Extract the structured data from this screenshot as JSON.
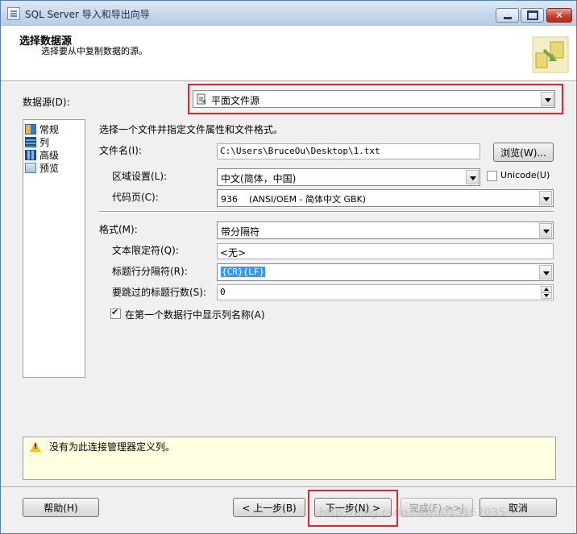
{
  "window": {
    "title": "SQL Server 导入和导出向导"
  },
  "header": {
    "title": "选择数据源",
    "subtitle": "选择要从中复制数据的源。"
  },
  "datasource": {
    "label": "数据源(D):",
    "value": "平面文件源"
  },
  "nav": {
    "items": [
      {
        "label": "常规",
        "icon": "general-icon"
      },
      {
        "label": "列",
        "icon": "columns-icon"
      },
      {
        "label": "高级",
        "icon": "advanced-icon"
      },
      {
        "label": "预览",
        "icon": "preview-icon"
      }
    ]
  },
  "form": {
    "intro": "选择一个文件并指定文件属性和文件格式。",
    "filename_label": "文件名(I):",
    "filename_value": "C:\\Users\\BruceOu\\Desktop\\1.txt",
    "browse_label": "浏览(W)...",
    "locale_label": "区域设置(L):",
    "locale_value": "中文(简体，中国)",
    "unicode_label": "Unicode(U)",
    "unicode_checked": false,
    "codepage_label": "代码页(C):",
    "codepage_value": "936    (ANSI/OEM - 简体中文 GBK)",
    "format_label": "格式(M):",
    "format_value": "带分隔符",
    "text_qualifier_label": "文本限定符(Q):",
    "text_qualifier_value": "<无>",
    "header_row_delim_label": "标题行分隔符(R):",
    "header_row_delim_value": "{CR}{LF}",
    "header_rows_skip_label": "要跳过的标题行数(S):",
    "header_rows_skip_value": "0",
    "column_names_label": "在第一个数据行中显示列名称(A)",
    "column_names_checked": true
  },
  "message": {
    "text": "没有为此连接管理器定义列。",
    "icon": "warning-icon"
  },
  "buttons": {
    "help": "帮助(H)",
    "back": "< 上一步(B)",
    "next": "下一步(N) >",
    "finish": "完成(F) >>|",
    "cancel": "取消"
  },
  "watermark": "http://blog.csdn.net/u013162035",
  "colors": {
    "highlight": "#e0262b",
    "selection": "#3399ff",
    "message_bg": "#ffffe1"
  }
}
